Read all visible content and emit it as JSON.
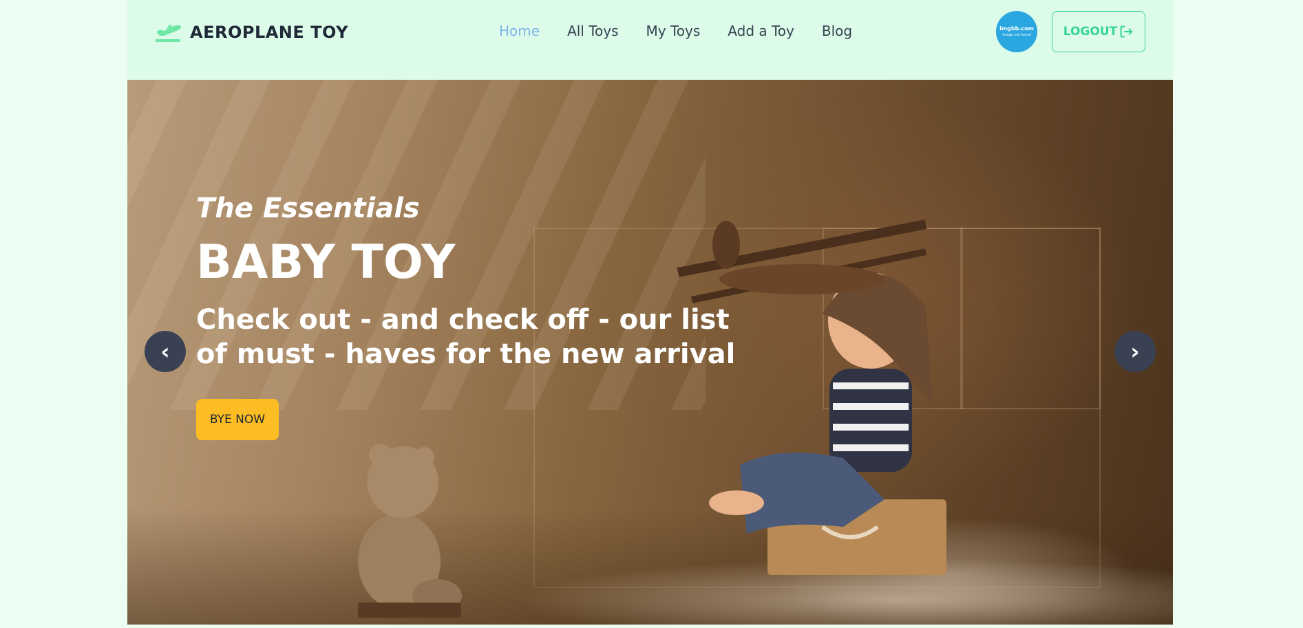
{
  "brand": {
    "name": "AEROPLANE TOY",
    "icon": "airplane-takeoff-icon"
  },
  "nav": {
    "items": [
      {
        "label": "Home",
        "active": true
      },
      {
        "label": "All Toys",
        "active": false
      },
      {
        "label": "My Toys",
        "active": false
      },
      {
        "label": "Add a Toy",
        "active": false
      },
      {
        "label": "Blog",
        "active": false
      }
    ]
  },
  "user": {
    "avatar_line1": "imgbb.com",
    "avatar_line2": "Image not found"
  },
  "logout": {
    "label": "LOGOUT",
    "icon": "logout-icon"
  },
  "hero": {
    "subtitle": "The Essentials",
    "title": "BABY TOY",
    "description": "Check out - and check off - our list of must - haves for the new arrival",
    "cta_label": "BYE NOW",
    "prev_label": "‹",
    "next_label": "›"
  },
  "colors": {
    "page_bg": "#ecfdf1",
    "navbar_bg": "#dcfbe9",
    "accent": "#36d399",
    "active_link": "#7fb6ea",
    "cta": "#fbbd23",
    "carousel_arrow": "#394153",
    "avatar_bg": "#2aa6e0"
  }
}
